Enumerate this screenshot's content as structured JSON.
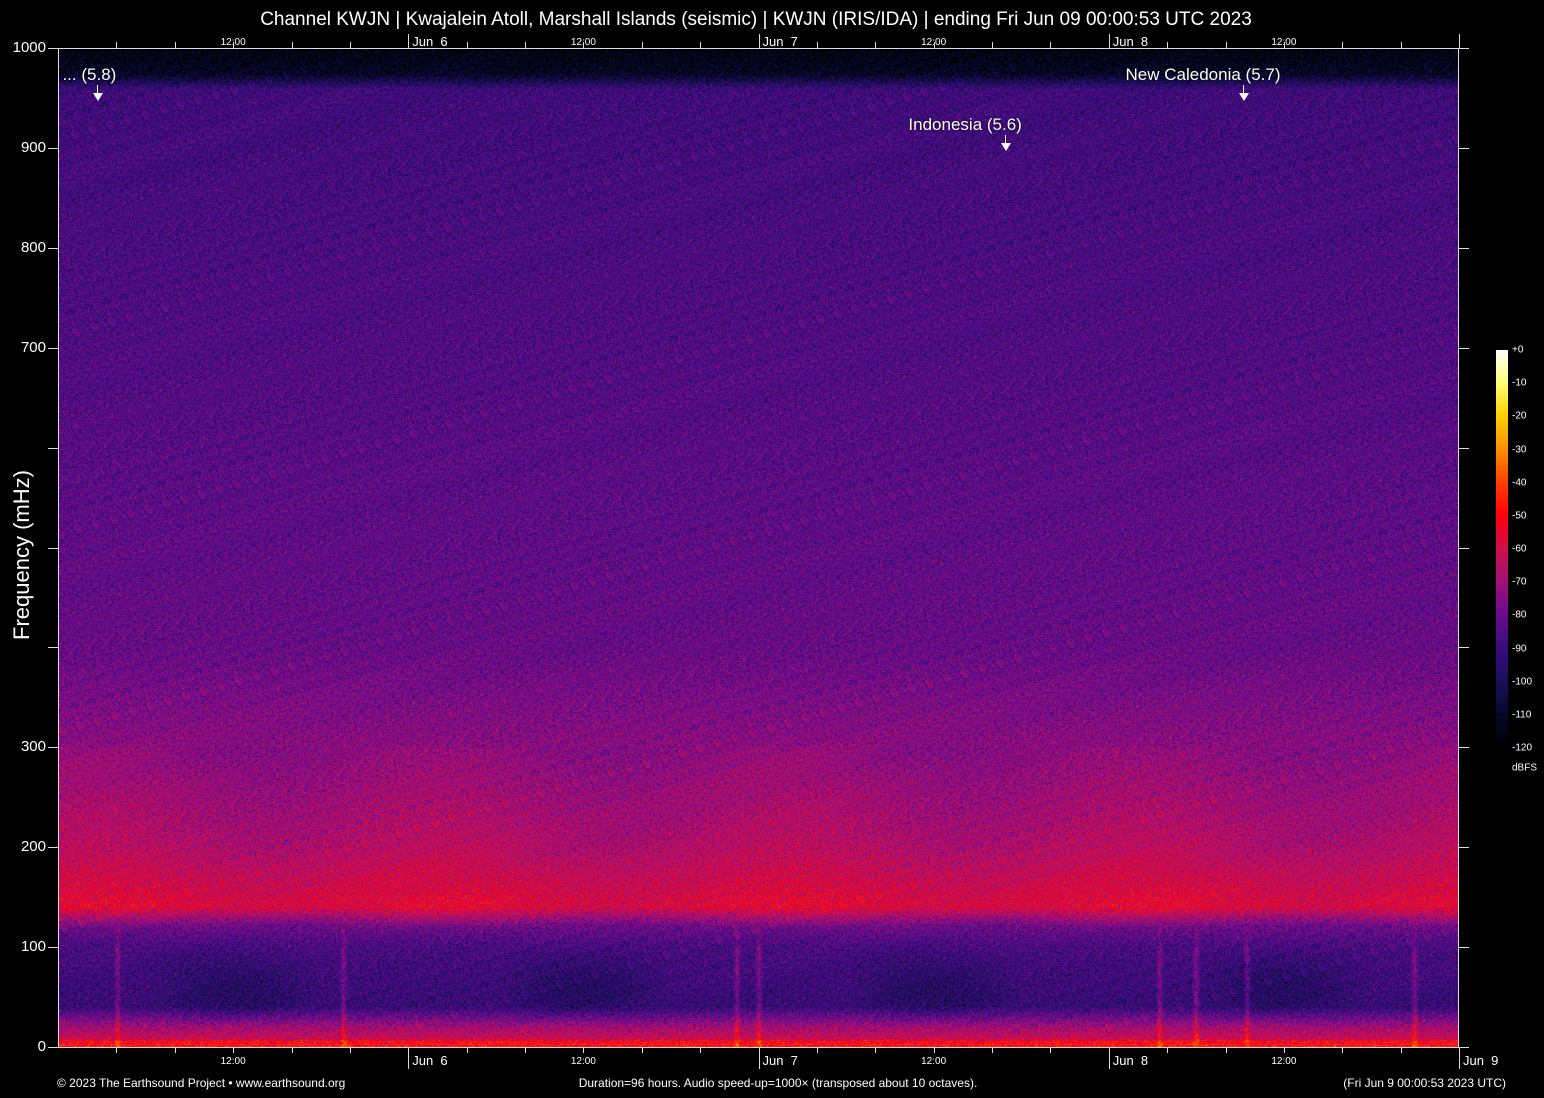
{
  "title": "Channel KWJN | Kwajalein Atoll, Marshall Islands (seismic) | KWJN (IRIS/IDA) | ending Fri Jun 09 00:00:53 UTC 2023",
  "footer": {
    "left": "© 2023 The Earthsound Project • www.earthsound.org",
    "center": "Duration=96 hours. Audio speed-up=1000× (transposed about 10 octaves).",
    "right": "(Fri Jun  9 00:00:53 2023 UTC)"
  },
  "chart_data": {
    "type": "heatmap",
    "title": "Channel KWJN | Kwajalein Atoll, Marshall Islands (seismic) | KWJN (IRIS/IDA) | ending Fri Jun 09 00:00:53 UTC 2023",
    "xlabel": "",
    "ylabel": "Frequency (mHz)",
    "ylim": [
      0,
      1000
    ],
    "y_ticks": [
      0,
      100,
      200,
      300,
      400,
      500,
      600,
      700,
      800,
      900,
      1000
    ],
    "y_tick_labels": [
      "0",
      "100",
      "200",
      "300",
      "",
      "",
      "",
      "700",
      "800",
      "900",
      "1000"
    ],
    "x_range_hours": [
      0,
      96
    ],
    "x_start": "Jun 5 00:00:53 UTC",
    "x_minor_tick_hours": 4,
    "x_tick_labels": [
      {
        "hour": 12,
        "label": "12:00",
        "kind": "small"
      },
      {
        "hour": 24,
        "label": "Jun  6",
        "kind": "day"
      },
      {
        "hour": 36,
        "label": "12:00",
        "kind": "small"
      },
      {
        "hour": 48,
        "label": "Jun  7",
        "kind": "day"
      },
      {
        "hour": 60,
        "label": "12:00",
        "kind": "small"
      },
      {
        "hour": 72,
        "label": "Jun  8",
        "kind": "day"
      },
      {
        "hour": 84,
        "label": "12:00",
        "kind": "small"
      },
      {
        "hour": 96,
        "label": "Jun  9",
        "kind": "day"
      }
    ],
    "annotations": [
      {
        "label": "... (5.8)",
        "hour": 2.7,
        "freq": 955
      },
      {
        "label": "Indonesia (5.6)",
        "hour": 64.9,
        "freq": 905
      },
      {
        "label": "New Caledonia (5.7)",
        "hour": 81.2,
        "freq": 955
      }
    ],
    "colorbar": {
      "label": "dBFS",
      "range": [
        -120,
        0
      ],
      "ticks": [
        "+0",
        "-10",
        "-20",
        "-30",
        "-40",
        "-50",
        "-60",
        "-70",
        "-80",
        "-90",
        "-100",
        "-110",
        "-120"
      ],
      "colors": [
        "#000000",
        "#08082e",
        "#1c0f5c",
        "#3a0c80",
        "#6a0c8c",
        "#a0107a",
        "#d0104a",
        "#ff0010",
        "#ff4000",
        "#ff9000",
        "#ffd000",
        "#ffff70",
        "#ffffff"
      ]
    },
    "intensity_profile_dbfs": [
      {
        "freq": 1000,
        "db": -118
      },
      {
        "freq": 975,
        "db": -112
      },
      {
        "freq": 960,
        "db": -90
      },
      {
        "freq": 700,
        "db": -86
      },
      {
        "freq": 400,
        "db": -81
      },
      {
        "freq": 300,
        "db": -74
      },
      {
        "freq": 200,
        "db": -66
      },
      {
        "freq": 140,
        "db": -57
      },
      {
        "freq": 120,
        "db": -80
      },
      {
        "freq": 100,
        "db": -88
      },
      {
        "freq": 40,
        "db": -92
      },
      {
        "freq": 20,
        "db": -70
      },
      {
        "freq": 0,
        "db": -56
      }
    ],
    "transient_hours": [
      4,
      19.5,
      46.5,
      48,
      75.5,
      78,
      81.5,
      93
    ]
  }
}
